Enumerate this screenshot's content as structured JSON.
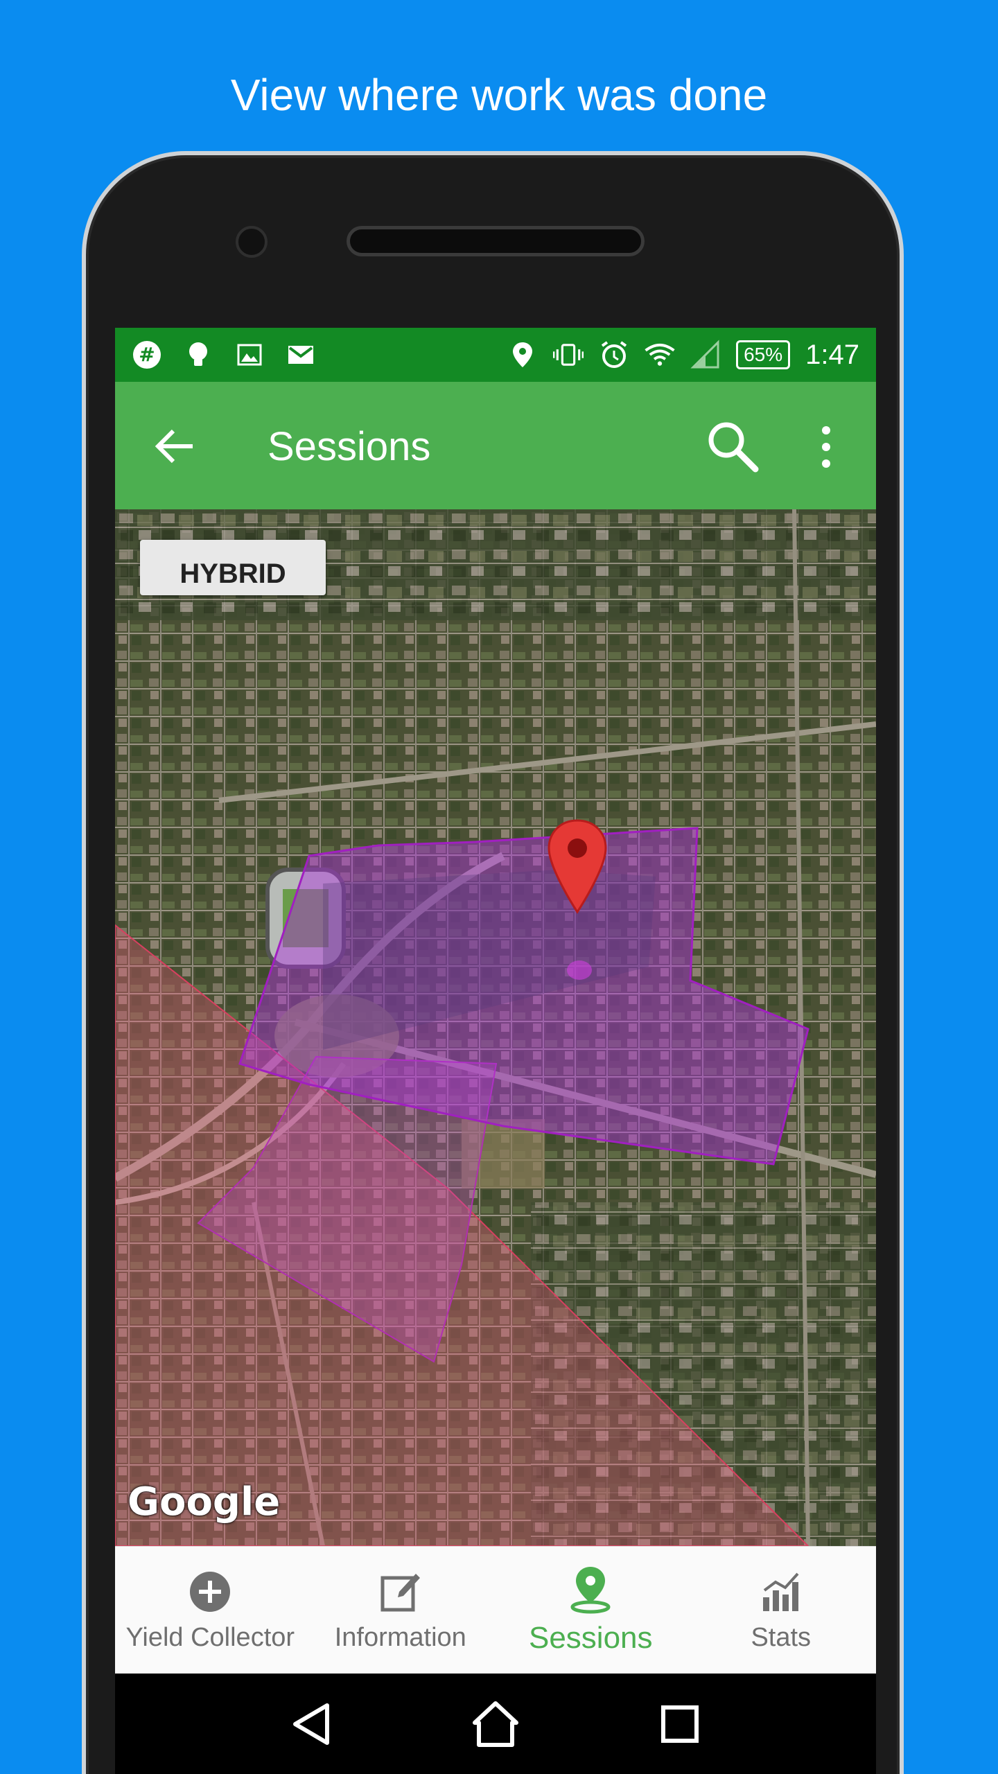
{
  "headline": "View where work was done",
  "status_bar": {
    "left_icons": [
      "hashtag-icon",
      "lightbulb-icon",
      "image-icon",
      "gmail-icon"
    ],
    "right_icons": [
      "location-icon",
      "vibrate-icon",
      "alarm-icon",
      "wifi-icon",
      "signal-icon"
    ],
    "battery": "65%",
    "time": "1:47"
  },
  "app_bar": {
    "title": "Sessions",
    "back_icon": "arrow-back-icon",
    "search_icon": "search-icon",
    "more_icon": "more-vert-icon",
    "color": "#4caf50",
    "status_color": "#138a24"
  },
  "map": {
    "type_button": "HYBRID",
    "attribution": "Google",
    "marker_icon": "map-pin-icon",
    "marker_color": "#e53935",
    "polygon_colors": [
      "#c040d0",
      "#e06080"
    ]
  },
  "bottom_nav": {
    "items": [
      {
        "label": "Yield Collector",
        "icon": "add-circle-icon",
        "active": false
      },
      {
        "label": "Information",
        "icon": "edit-note-icon",
        "active": false
      },
      {
        "label": "Sessions",
        "icon": "location-pin-icon",
        "active": true
      },
      {
        "label": "Stats",
        "icon": "bar-chart-icon",
        "active": false
      }
    ],
    "active_color": "#4caf50"
  },
  "system_nav": [
    "back-triangle-icon",
    "home-icon",
    "recents-square-icon"
  ]
}
